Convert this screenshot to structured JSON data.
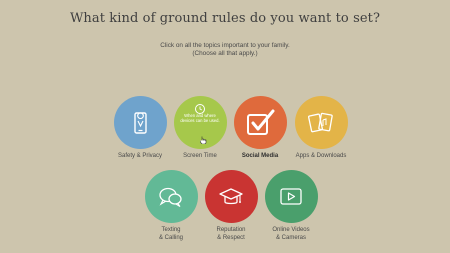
{
  "header": {
    "title": "What kind of ground rules do you want to set?",
    "instruction_line1": "Click on all the topics important to your family.",
    "instruction_line2": "(Choose all that apply.)"
  },
  "topics": [
    {
      "label": "Safety & Privacy",
      "icon": "phone-location-icon",
      "color": "#6fa3cc",
      "selected": false
    },
    {
      "label": "Screen Time",
      "icon": "clock-icon",
      "color": "#a6c84b",
      "selected": false,
      "hover_text": "When and where devices can be used."
    },
    {
      "label": "Social Media",
      "icon": "checkmark-icon",
      "color": "#df6a3c",
      "selected": true
    },
    {
      "label": "Apps & Downloads",
      "icon": "apps-icon",
      "color": "#e3b448",
      "selected": false
    },
    {
      "label": "Texting",
      "label2": "& Calling",
      "icon": "chat-bubbles-icon",
      "color": "#62b996",
      "selected": false
    },
    {
      "label": "Reputation",
      "label2": "& Respect",
      "icon": "graduation-cap-icon",
      "color": "#c93432",
      "selected": false
    },
    {
      "label": "Online Videos",
      "label2": "& Cameras",
      "icon": "video-icon",
      "color": "#4a9f6c",
      "selected": false
    }
  ]
}
